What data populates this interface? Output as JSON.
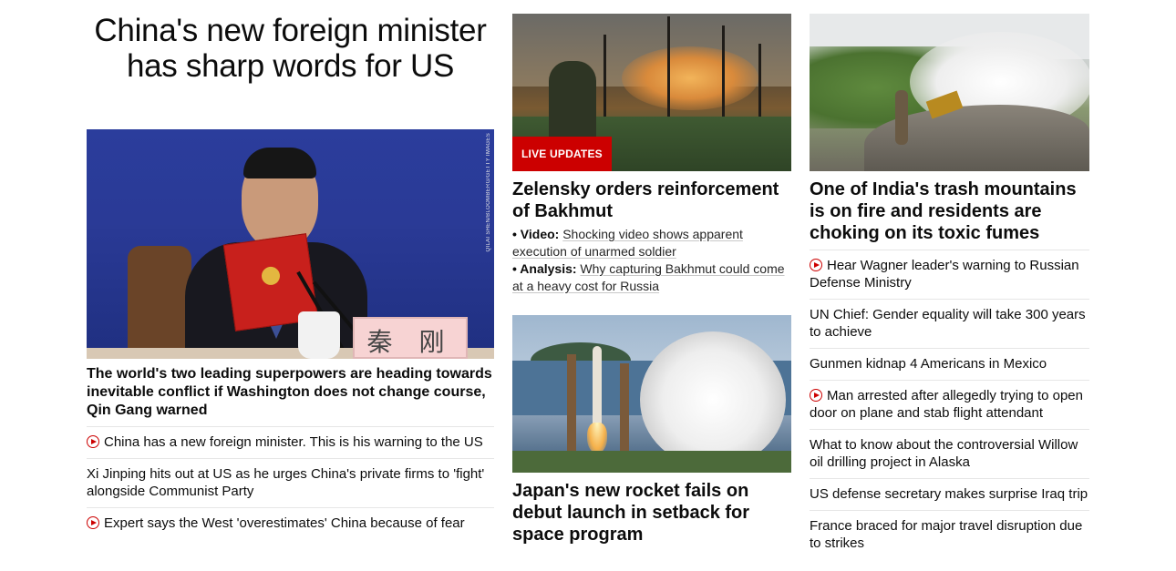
{
  "left": {
    "headline": "China's new foreign minister has sharp words for US",
    "image": {
      "credit": "QILAI SHEN/BLOOMBERG/GETTY IMAGES",
      "nameplate": "秦 刚"
    },
    "summary": "The world's two leading superpowers are heading towards inevitable conflict if Washington does not change course, Qin Gang warned",
    "links": [
      {
        "video": true,
        "text": "China has a new foreign minister. This is his warning to the US"
      },
      {
        "video": false,
        "text": "Xi Jinping hits out at US as he urges China's private firms to 'fight' alongside Communist Party"
      },
      {
        "video": true,
        "text": "Expert says the West 'overestimates' China because of fear"
      }
    ]
  },
  "middle": {
    "story1": {
      "badge": "LIVE UPDATES",
      "headline": "Zelensky orders reinforcement of Bakhmut",
      "bullets": [
        {
          "label": "Video:",
          "text": "Shocking video shows apparent execution of unarmed soldier"
        },
        {
          "label": "Analysis:",
          "text": "Why capturing Bakhmut could come at a heavy cost for Russia"
        }
      ]
    },
    "story2": {
      "headline": "Japan's new rocket fails on debut launch in setback for space program"
    }
  },
  "right": {
    "headline": "One of India's trash mountains is on fire and residents are choking on its toxic fumes",
    "links": [
      {
        "video": true,
        "text": "Hear Wagner leader's warning to Russian Defense Ministry"
      },
      {
        "video": false,
        "text": "UN Chief: Gender equality will take 300 years to achieve"
      },
      {
        "video": false,
        "text": "Gunmen kidnap 4 Americans in Mexico"
      },
      {
        "video": true,
        "text": "Man arrested after allegedly trying to open door on plane and stab flight attendant"
      },
      {
        "video": false,
        "text": "What to know about the controversial Willow oil drilling project in Alaska"
      },
      {
        "video": false,
        "text": "US defense secretary makes surprise Iraq trip"
      },
      {
        "video": false,
        "text": "France braced for major travel disruption due to strikes"
      }
    ]
  },
  "colors": {
    "accent": "#cc0000",
    "text": "#0c0c0c",
    "divider": "#e6e6e6"
  },
  "icons": {
    "video": "play-circle-icon"
  }
}
